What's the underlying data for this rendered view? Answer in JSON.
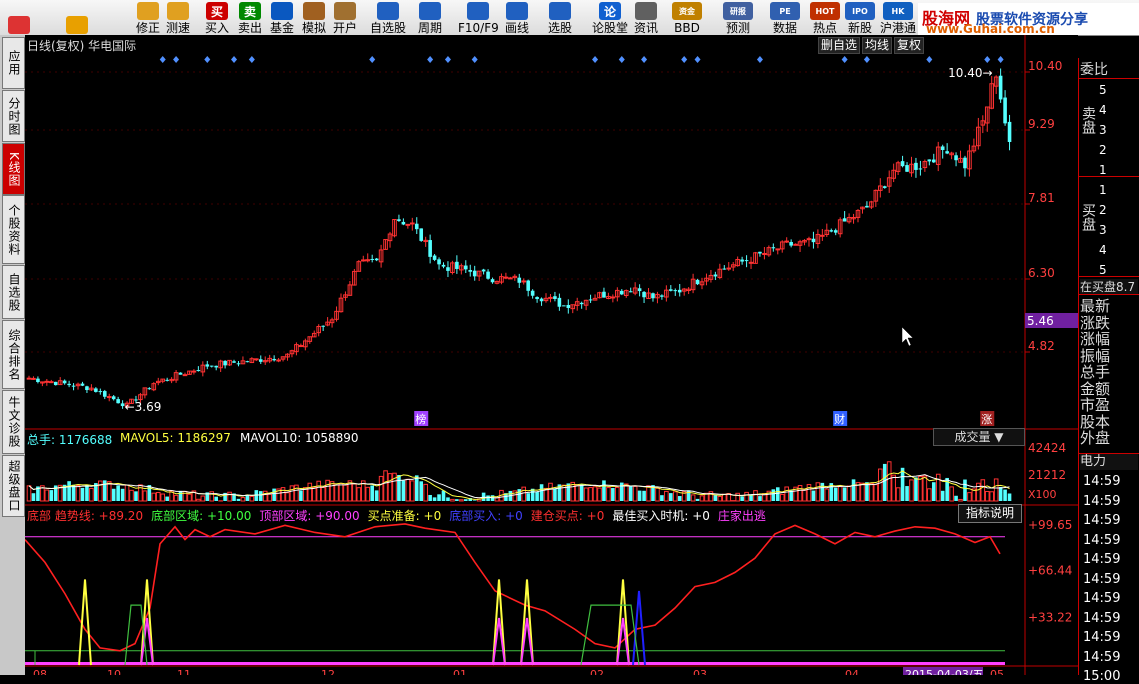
{
  "toolbar": {
    "buttons": [
      {
        "label": "",
        "icon": "grid-icon"
      },
      {
        "label": "",
        "icon": "back-arrow-icon"
      },
      {
        "label": "修正",
        "icon": "up-down-arrow-icon"
      },
      {
        "label": "测速",
        "icon": "gauge-icon"
      },
      {
        "label": "买入",
        "icon": "buy-icon",
        "glyph": "买"
      },
      {
        "label": "卖出",
        "icon": "sell-icon",
        "glyph": "卖"
      },
      {
        "label": "基金",
        "icon": "fund-icon"
      },
      {
        "label": "模拟",
        "icon": "hammer-icon"
      },
      {
        "label": "开户",
        "icon": "briefcase-icon"
      },
      {
        "label": "自选股",
        "icon": "star-icon"
      },
      {
        "label": "周期",
        "icon": "clock-icon"
      },
      {
        "label": "F10/F9",
        "icon": "document-icon"
      },
      {
        "label": "画线",
        "icon": "pencil-icon"
      },
      {
        "label": "选股",
        "icon": "monitor-icon"
      },
      {
        "label": "论股堂",
        "icon": "discuss-icon",
        "glyph": "论"
      },
      {
        "label": "资讯",
        "icon": "news-icon"
      },
      {
        "label": "BBD",
        "icon": "gold-icon",
        "glyph": "资金"
      },
      {
        "label": "预测",
        "icon": "research-icon",
        "glyph": "研报"
      },
      {
        "label": "数据",
        "icon": "pe-icon",
        "glyph": "PE"
      },
      {
        "label": "热点",
        "icon": "hot-icon",
        "glyph": "HOT"
      },
      {
        "label": "新股",
        "icon": "newstock-icon",
        "glyph": "IPO"
      },
      {
        "label": "沪港通",
        "icon": "hk-icon",
        "glyph": "HK"
      }
    ],
    "banner": {
      "site": "股海网",
      "desc": "股票软件资源分享",
      "url": "www.Guhai.com.cn"
    }
  },
  "left_nav": [
    "应用",
    "分时图",
    "K线图",
    "个股资料",
    "自选股",
    "综合排名",
    "牛文诊股",
    "超级盘口"
  ],
  "chart_header": {
    "title": "日线(复权) 华电国际",
    "right_buttons": [
      "删自选",
      "均线",
      "复权"
    ]
  },
  "price_axis": [
    "10.40",
    "9.29",
    "7.81",
    "6.30",
    "5.46",
    "4.82"
  ],
  "price_current": "5.46",
  "annotations": {
    "high": "10.40",
    "low": "3.69",
    "markers": [
      "榜",
      "财",
      "涨"
    ]
  },
  "volume_header": {
    "total": "总手: 1176688",
    "ma5": "MAVOL5: 1186297",
    "ma10": "MAVOL10: 1058890",
    "dropdown": "成交量"
  },
  "volume_axis": [
    "42424",
    "21212",
    "X100"
  ],
  "indicator_header": {
    "items": [
      {
        "text": "底部 趋势线: +89.20",
        "color": "#ff3030"
      },
      {
        "text": "底部区域: +10.00",
        "color": "#40ff40"
      },
      {
        "text": "顶部区域: +90.00",
        "color": "#ff40ff"
      },
      {
        "text": "买点准备: +0",
        "color": "#ffff40"
      },
      {
        "text": "底部买入: +0",
        "color": "#4040ff"
      },
      {
        "text": "建仓买点: +0",
        "color": "#ff3030"
      },
      {
        "text": "最佳买入时机: +0",
        "color": "#ffffff"
      },
      {
        "text": "庄家出逃",
        "color": "#ff40ff"
      }
    ],
    "help_button": "指标说明"
  },
  "indicator_axis": [
    "+99.65",
    "+66.44",
    "+33.22"
  ],
  "date_axis": [
    "08",
    "10",
    "11",
    "12",
    "01",
    "02",
    "03",
    "04",
    "2015-04-03/五",
    "05"
  ],
  "right_panel": {
    "wei_bi": "委比",
    "sell_label": "卖盘",
    "buy_label": "买盘",
    "sell_levels": [
      "5",
      "4",
      "3",
      "2",
      "1"
    ],
    "buy_levels": [
      "1",
      "2",
      "3",
      "4",
      "5"
    ],
    "in_buy": "在买盘8.7",
    "stats": [
      "最新",
      "涨跌",
      "涨幅",
      "振幅",
      "总手",
      "金额",
      "市盈",
      "股本",
      "外盘"
    ],
    "power": "电力",
    "times": [
      "14:59",
      "14:59",
      "14:59",
      "14:59",
      "14:59",
      "14:59",
      "14:59",
      "14:59",
      "14:59",
      "14:59",
      "15:00"
    ]
  },
  "colors": {
    "up": "#ff3232",
    "down": "#54ffff",
    "axis": "#c00000",
    "ma": "#ffffff"
  }
}
